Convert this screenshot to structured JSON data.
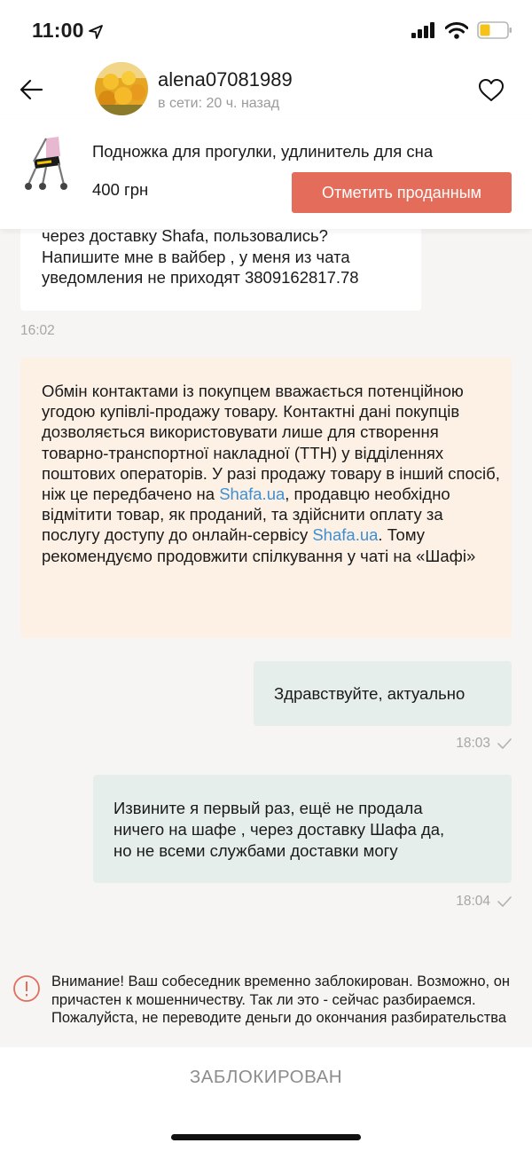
{
  "status_bar": {
    "time": "11:00"
  },
  "header": {
    "username": "alena07081989",
    "online_status": "в сети: 20 ч. назад"
  },
  "product": {
    "title": "Подножка для прогулки,  удлинитель для сна",
    "price": "400 грн",
    "sold_button_label": "Отметить проданным"
  },
  "messages": [
    {
      "direction": "in",
      "text": "через доставку Shafa, пользовались?\nНапишите мне в вайбер , у меня из чата\nуведомления не приходят 3809162817.78",
      "time": "16:02"
    },
    {
      "direction": "out",
      "text": "Здравствуйте, актуально",
      "time": "18:03"
    },
    {
      "direction": "out",
      "text": "Извините я первый раз, ещё не продала\nничего на шафе , через доставку Шафа да,\nно не всеми службами доставки могу",
      "time": "18:04"
    }
  ],
  "notice": {
    "part1": "Обмін контактами із покупцем вважається потенційною угодою купівлі-продажу товару. Контактні дані покупців дозволяється використовувати лише для створення товарно-транспортної накладної (ТТН) у відділеннях поштових операторів. У разі продажу товару в інший спосіб, ніж це передбачено на ",
    "link1": "Shafa.ua",
    "part2": ", продавцю необхідно відмітити товар, як проданий, та здійснити оплату за послугу доступу до онлайн-сервісу ",
    "link2": "Shafa.ua",
    "part3": ". Тому рекомендуємо продовжити спілкування у чаті на «Шафі»",
    "link_color": "#3d8fd6"
  },
  "warning": {
    "text": "Внимание! Ваш собеседник временно заблокирован. Возможно, он причастен к мошенничеству. Так ли это - сейчас разбираемся. Пожалуйста, не переводите деньги до окончания разбирательства"
  },
  "footer": {
    "blocked_label": "ЗАБЛОКИРОВАН"
  },
  "colors": {
    "accent": "#e36d5a",
    "notice_bg": "#fdf1e6",
    "outgoing_bg": "#e6eeec",
    "warning_icon": "#e36d5a"
  },
  "icons": [
    "location-arrow-icon",
    "signal-icon",
    "wifi-icon",
    "battery-icon",
    "back-arrow-icon",
    "heart-icon",
    "checkmark-icon",
    "alert-icon"
  ]
}
